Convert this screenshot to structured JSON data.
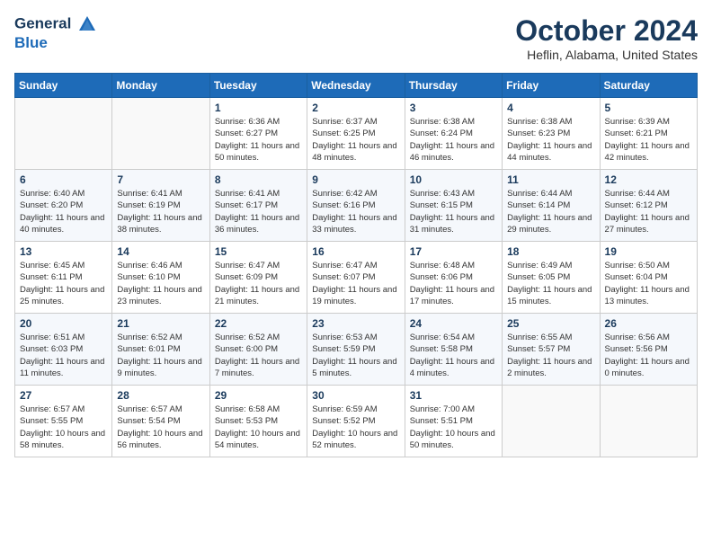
{
  "header": {
    "logo_line1": "General",
    "logo_line2": "Blue",
    "month_title": "October 2024",
    "location": "Heflin, Alabama, United States"
  },
  "calendar": {
    "days_of_week": [
      "Sunday",
      "Monday",
      "Tuesday",
      "Wednesday",
      "Thursday",
      "Friday",
      "Saturday"
    ],
    "weeks": [
      [
        {
          "day": "",
          "info": ""
        },
        {
          "day": "",
          "info": ""
        },
        {
          "day": "1",
          "info": "Sunrise: 6:36 AM\nSunset: 6:27 PM\nDaylight: 11 hours and 50 minutes."
        },
        {
          "day": "2",
          "info": "Sunrise: 6:37 AM\nSunset: 6:25 PM\nDaylight: 11 hours and 48 minutes."
        },
        {
          "day": "3",
          "info": "Sunrise: 6:38 AM\nSunset: 6:24 PM\nDaylight: 11 hours and 46 minutes."
        },
        {
          "day": "4",
          "info": "Sunrise: 6:38 AM\nSunset: 6:23 PM\nDaylight: 11 hours and 44 minutes."
        },
        {
          "day": "5",
          "info": "Sunrise: 6:39 AM\nSunset: 6:21 PM\nDaylight: 11 hours and 42 minutes."
        }
      ],
      [
        {
          "day": "6",
          "info": "Sunrise: 6:40 AM\nSunset: 6:20 PM\nDaylight: 11 hours and 40 minutes."
        },
        {
          "day": "7",
          "info": "Sunrise: 6:41 AM\nSunset: 6:19 PM\nDaylight: 11 hours and 38 minutes."
        },
        {
          "day": "8",
          "info": "Sunrise: 6:41 AM\nSunset: 6:17 PM\nDaylight: 11 hours and 36 minutes."
        },
        {
          "day": "9",
          "info": "Sunrise: 6:42 AM\nSunset: 6:16 PM\nDaylight: 11 hours and 33 minutes."
        },
        {
          "day": "10",
          "info": "Sunrise: 6:43 AM\nSunset: 6:15 PM\nDaylight: 11 hours and 31 minutes."
        },
        {
          "day": "11",
          "info": "Sunrise: 6:44 AM\nSunset: 6:14 PM\nDaylight: 11 hours and 29 minutes."
        },
        {
          "day": "12",
          "info": "Sunrise: 6:44 AM\nSunset: 6:12 PM\nDaylight: 11 hours and 27 minutes."
        }
      ],
      [
        {
          "day": "13",
          "info": "Sunrise: 6:45 AM\nSunset: 6:11 PM\nDaylight: 11 hours and 25 minutes."
        },
        {
          "day": "14",
          "info": "Sunrise: 6:46 AM\nSunset: 6:10 PM\nDaylight: 11 hours and 23 minutes."
        },
        {
          "day": "15",
          "info": "Sunrise: 6:47 AM\nSunset: 6:09 PM\nDaylight: 11 hours and 21 minutes."
        },
        {
          "day": "16",
          "info": "Sunrise: 6:47 AM\nSunset: 6:07 PM\nDaylight: 11 hours and 19 minutes."
        },
        {
          "day": "17",
          "info": "Sunrise: 6:48 AM\nSunset: 6:06 PM\nDaylight: 11 hours and 17 minutes."
        },
        {
          "day": "18",
          "info": "Sunrise: 6:49 AM\nSunset: 6:05 PM\nDaylight: 11 hours and 15 minutes."
        },
        {
          "day": "19",
          "info": "Sunrise: 6:50 AM\nSunset: 6:04 PM\nDaylight: 11 hours and 13 minutes."
        }
      ],
      [
        {
          "day": "20",
          "info": "Sunrise: 6:51 AM\nSunset: 6:03 PM\nDaylight: 11 hours and 11 minutes."
        },
        {
          "day": "21",
          "info": "Sunrise: 6:52 AM\nSunset: 6:01 PM\nDaylight: 11 hours and 9 minutes."
        },
        {
          "day": "22",
          "info": "Sunrise: 6:52 AM\nSunset: 6:00 PM\nDaylight: 11 hours and 7 minutes."
        },
        {
          "day": "23",
          "info": "Sunrise: 6:53 AM\nSunset: 5:59 PM\nDaylight: 11 hours and 5 minutes."
        },
        {
          "day": "24",
          "info": "Sunrise: 6:54 AM\nSunset: 5:58 PM\nDaylight: 11 hours and 4 minutes."
        },
        {
          "day": "25",
          "info": "Sunrise: 6:55 AM\nSunset: 5:57 PM\nDaylight: 11 hours and 2 minutes."
        },
        {
          "day": "26",
          "info": "Sunrise: 6:56 AM\nSunset: 5:56 PM\nDaylight: 11 hours and 0 minutes."
        }
      ],
      [
        {
          "day": "27",
          "info": "Sunrise: 6:57 AM\nSunset: 5:55 PM\nDaylight: 10 hours and 58 minutes."
        },
        {
          "day": "28",
          "info": "Sunrise: 6:57 AM\nSunset: 5:54 PM\nDaylight: 10 hours and 56 minutes."
        },
        {
          "day": "29",
          "info": "Sunrise: 6:58 AM\nSunset: 5:53 PM\nDaylight: 10 hours and 54 minutes."
        },
        {
          "day": "30",
          "info": "Sunrise: 6:59 AM\nSunset: 5:52 PM\nDaylight: 10 hours and 52 minutes."
        },
        {
          "day": "31",
          "info": "Sunrise: 7:00 AM\nSunset: 5:51 PM\nDaylight: 10 hours and 50 minutes."
        },
        {
          "day": "",
          "info": ""
        },
        {
          "day": "",
          "info": ""
        }
      ]
    ]
  }
}
